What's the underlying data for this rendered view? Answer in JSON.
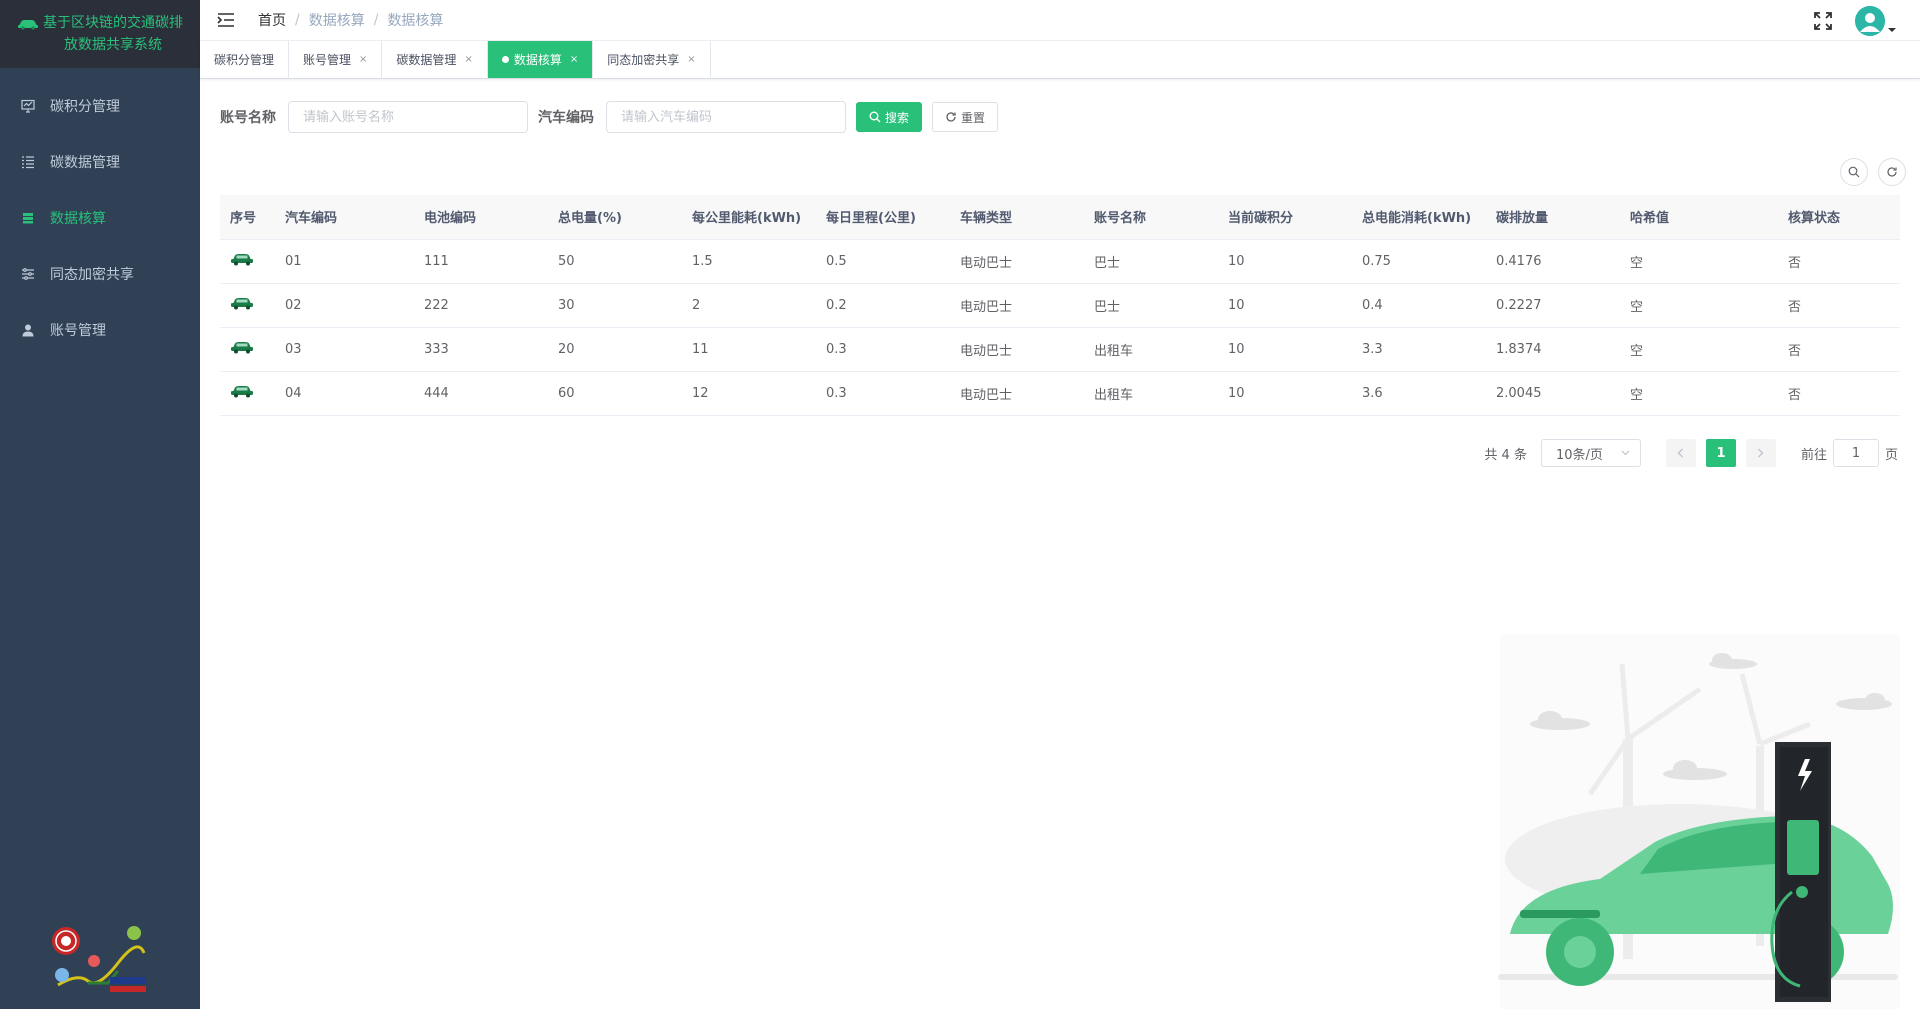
{
  "app": {
    "title_line1": "基于区块链的交通碳排",
    "title_line2": "放数据共享系统"
  },
  "sidebar": {
    "items": [
      {
        "label": "碳积分管理",
        "icon": "monitor-icon",
        "active": false
      },
      {
        "label": "碳数据管理",
        "icon": "list-icon",
        "active": false
      },
      {
        "label": "数据核算",
        "icon": "database-icon",
        "active": true
      },
      {
        "label": "同态加密共享",
        "icon": "sliders-icon",
        "active": false
      },
      {
        "label": "账号管理",
        "icon": "user-icon",
        "active": false
      }
    ]
  },
  "header": {
    "breadcrumb": [
      "首页",
      "数据核算",
      "数据核算"
    ]
  },
  "tabs": [
    {
      "label": "碳积分管理",
      "closable": false,
      "active": false
    },
    {
      "label": "账号管理",
      "closable": true,
      "active": false
    },
    {
      "label": "碳数据管理",
      "closable": true,
      "active": false
    },
    {
      "label": "数据核算",
      "closable": true,
      "active": true
    },
    {
      "label": "同态加密共享",
      "closable": true,
      "active": false
    }
  ],
  "search": {
    "account_label": "账号名称",
    "account_placeholder": "请输入账号名称",
    "car_label": "汽车编码",
    "car_placeholder": "请输入汽车编码",
    "search_btn": "搜索",
    "reset_btn": "重置"
  },
  "table": {
    "columns": [
      "序号",
      "汽车编码",
      "电池编码",
      "总电量(%)",
      "每公里能耗(kWh)",
      "每日里程(公里)",
      "车辆类型",
      "账号名称",
      "当前碳积分",
      "总电能消耗(kWh)",
      "碳排放量",
      "哈希值",
      "核算状态"
    ],
    "rows": [
      [
        "01",
        "111",
        "50",
        "1.5",
        "0.5",
        "电动巴士",
        "巴士",
        "10",
        "0.75",
        "0.4176",
        "空",
        "否"
      ],
      [
        "02",
        "222",
        "30",
        "2",
        "0.2",
        "电动巴士",
        "巴士",
        "10",
        "0.4",
        "0.2227",
        "空",
        "否"
      ],
      [
        "03",
        "333",
        "20",
        "11",
        "0.3",
        "电动巴士",
        "出租车",
        "10",
        "3.3",
        "1.8374",
        "空",
        "否"
      ],
      [
        "04",
        "444",
        "60",
        "12",
        "0.3",
        "电动巴士",
        "出租车",
        "10",
        "3.6",
        "2.0045",
        "空",
        "否"
      ]
    ]
  },
  "pagination": {
    "total": "共 4 条",
    "page_size": "10条/页",
    "current_page": "1",
    "goto_label": "前往",
    "goto_value": "1",
    "page_suffix": "页"
  },
  "colors": {
    "accent": "#29c07a",
    "sidebar_bg": "#304156",
    "logo_bg": "#2b2f3a"
  }
}
